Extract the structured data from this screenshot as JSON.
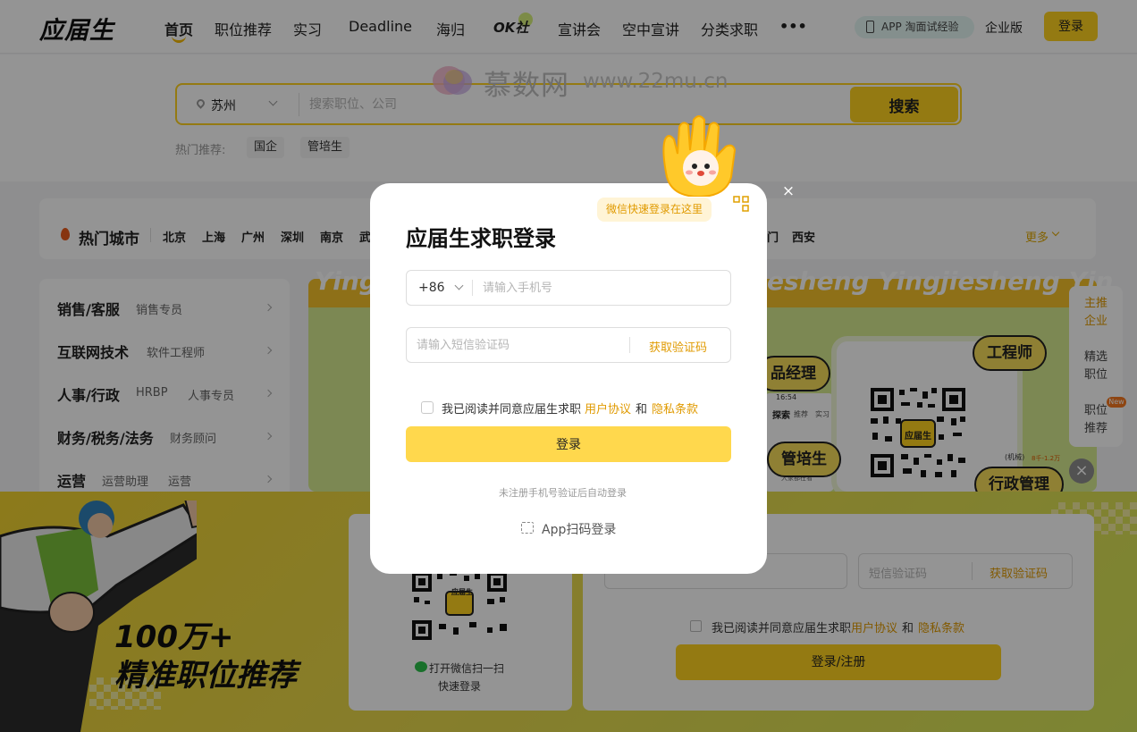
{
  "header": {
    "logo": "应届生",
    "nav": [
      "首页",
      "职位推荐",
      "实习",
      "Deadline",
      "海归",
      "OK社",
      "宣讲会",
      "空中宣讲",
      "分类求职",
      "•••"
    ],
    "app_pill": "APP 淘面试经验",
    "enterprise": "企业版",
    "login": "登录"
  },
  "watermark": {
    "text": "慕数网",
    "url": "www.22mu.cn"
  },
  "search": {
    "location": "苏州",
    "placeholder": "搜索职位、公司",
    "button": "搜索",
    "hot_label": "热门推荐:",
    "hot_tags": [
      "国企",
      "管培生"
    ]
  },
  "cities": {
    "title": "热门城市",
    "items": [
      "北京",
      "上海",
      "广州",
      "深圳",
      "南京",
      "武",
      "门",
      "西安"
    ],
    "more": "更多"
  },
  "categories": [
    {
      "title": "销售/客服",
      "subs": [
        "销售专员"
      ]
    },
    {
      "title": "互联网技术",
      "subs": [
        "软件工程师"
      ]
    },
    {
      "title": "人事/行政",
      "subs": [
        "HRBP",
        "人事专员"
      ]
    },
    {
      "title": "财务/税务/法务",
      "subs": [
        "财务顾问"
      ]
    },
    {
      "title": "运营",
      "subs": [
        "运营助理",
        "运营"
      ]
    }
  ],
  "banner": {
    "letters_left": "Ying",
    "letters_right": "esheng  Yingjiesheng  Yin",
    "pills": [
      "品经理",
      "工程师",
      "管培生",
      "行政管理"
    ],
    "app_logo": "应届生",
    "screen_text": [
      "16:54",
      "探索",
      "推荐",
      "实习",
      "大家都在看",
      "(机械)",
      "8千-1.2万"
    ]
  },
  "side_nav": {
    "items": [
      "主推企业",
      "精选职位",
      "职位推荐"
    ],
    "badge": "New"
  },
  "promo": {
    "line1": "100万+",
    "line2": "精准职位推荐",
    "qr_logo": "应届生",
    "qr_text1": "打开微信扫一扫",
    "qr_text2": "快速登录",
    "code_placeholder": "短信验证码",
    "get_code": "获取验证码",
    "agree_prefix": "我已阅读并同意应届生求职",
    "user_agreement": "用户协议",
    "and": "和",
    "privacy": "隐私条款",
    "submit": "登录/注册"
  },
  "modal": {
    "wechat_tip": "微信快速登录在这里",
    "close": "×",
    "title": "应届生求职登录",
    "country_code": "+86",
    "phone_placeholder": "请输入手机号",
    "code_placeholder": "请输入短信验证码",
    "get_code": "获取验证码",
    "agree_prefix": "我已阅读并同意应届生求职",
    "user_agreement": "用户协议",
    "and": "和",
    "privacy": "隐私条款",
    "submit": "登录",
    "note": "未注册手机号验证后自动登录",
    "app_login": "App扫码登录"
  },
  "colors": {
    "brand_yellow": "#ffd21f",
    "link_orange": "#e09a00",
    "overlay": "rgba(0,0,0,0.42)"
  }
}
